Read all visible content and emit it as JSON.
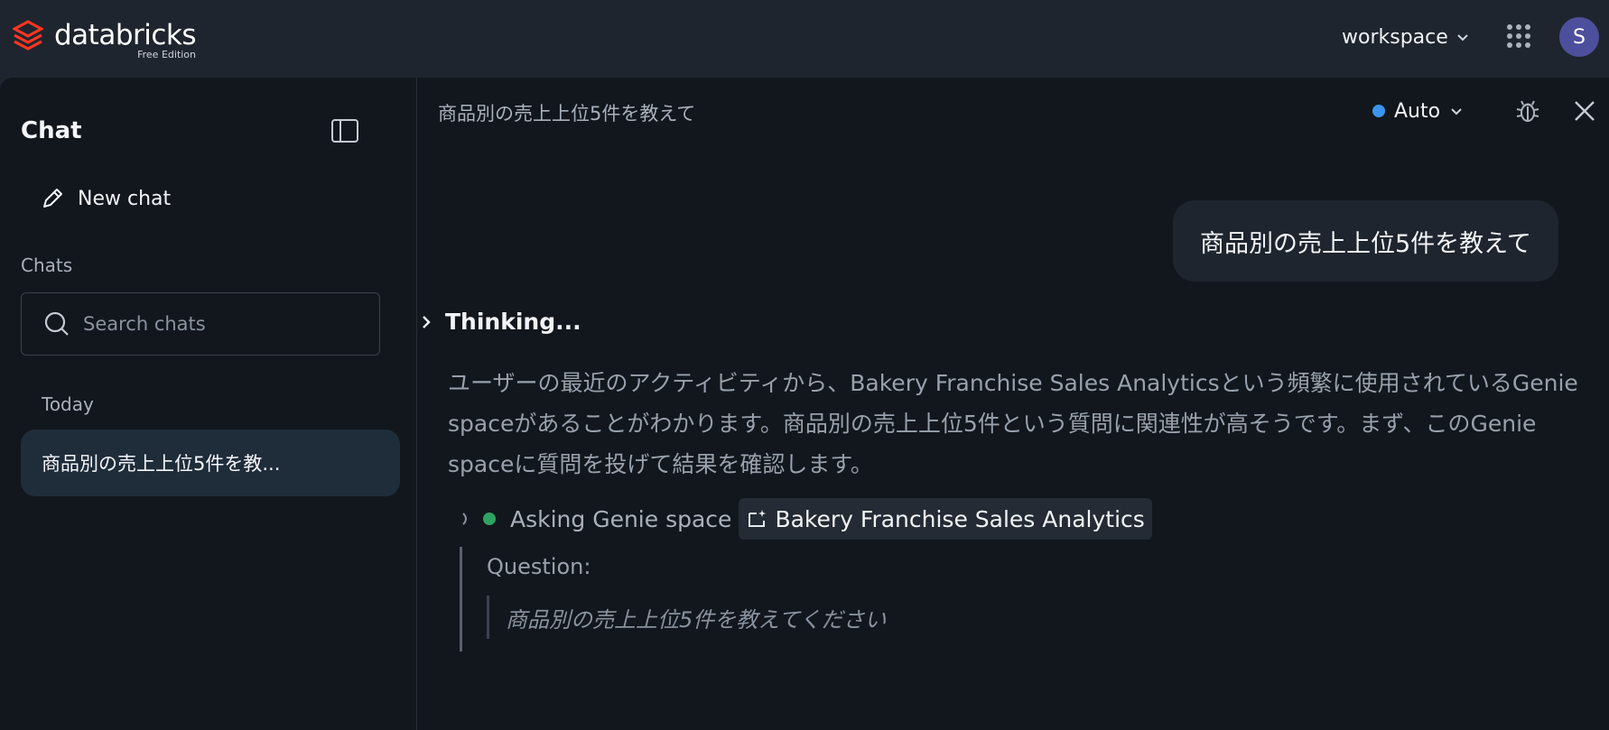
{
  "header": {
    "brand_name": "databricks",
    "brand_edition": "Free Edition",
    "workspace_label": "workspace",
    "avatar_initial": "S",
    "brand_color": "#ff3621"
  },
  "sidebar": {
    "title": "Chat",
    "new_chat_label": "New chat",
    "chats_section_label": "Chats",
    "search_placeholder": "Search chats",
    "today_label": "Today",
    "chat_items": [
      {
        "label": "商品別の売上上位5件を教..."
      }
    ]
  },
  "conversation": {
    "title": "商品別の売上上位5件を教えて",
    "model_label": "Auto",
    "user_message": "商品別の売上上位5件を教えて",
    "thinking_label": "Thinking...",
    "reasoning_text": "ユーザーの最近のアクティビティから、Bakery Franchise Sales Analyticsという頻繁に使用されているGenie spaceがあることがわかります。商品別の売上上位5件という質問に関連性が高そうです。まず、このGenie spaceに質問を投げて結果を確認します。",
    "tool_call": {
      "action_label": "Asking Genie space",
      "space_name": "Bakery Franchise Sales Analytics",
      "question_label": "Question:",
      "question_text": "商品別の売上上位5件を教えてください"
    }
  }
}
